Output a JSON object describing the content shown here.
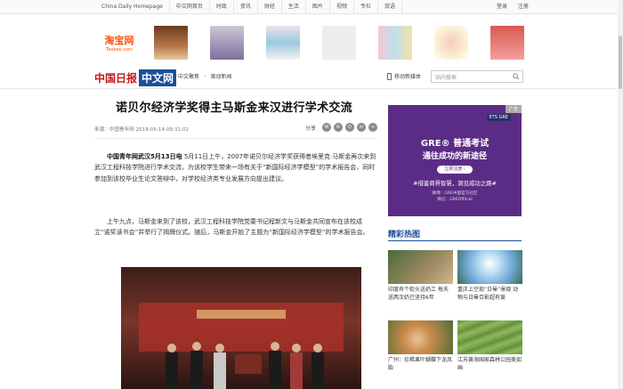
{
  "topnav": {
    "links": [
      "China Daily Homepage",
      "中文网首页",
      "时政",
      "资讯",
      "财经",
      "生活",
      "图片",
      "视频",
      "专栏",
      "双语"
    ],
    "login": "登录",
    "register": "注册"
  },
  "ads": {
    "taobao_logo": "淘宝网",
    "taobao_sub": "Taobao.com"
  },
  "header": {
    "logo_cn": "中国日报",
    "logo_site": "中文网",
    "breadcrumb": [
      "中文聚焦",
      "滚动新闻"
    ],
    "mobile_label": "移动新媒体",
    "search_placeholder": "站内搜索"
  },
  "article": {
    "title": "诺贝尔经济学奖得主马斯金来汉进行学术交流",
    "source": "来源：中国青年网 2018-05-14 09:31:02",
    "share_label": "分享",
    "share_icons": [
      "weibo-icon",
      "wechat-icon",
      "qq-icon",
      "linkedin-icon",
      "plus-icon"
    ],
    "lead": "中国青年网武汉5月13日电",
    "p1": " 5月11日上午，2007年诺贝尔经济学奖获得者埃里克·马斯金再次来到武汉工程科技学院进行学术交流，为该校学生带来一场有关于“新国际经济学模型”的学术报告会，同时参加到该校毕业生论文答辩中，对学校经济类专业发展方向提出建议。",
    "p2": "上午九点，马斯金来到了该校，武汉工程科技学院党委书记程新文与马斯金共同宣布在该校成立“诺奖读书会”并举行了揭牌仪式。随后，马斯金开始了主题为“新国际经济学模型”的学术报告会。"
  },
  "sidebar": {
    "ad_badge": "广告",
    "ad_ets": "ETS GRE",
    "ad_headline1": "GRE® 普通考试",
    "ad_headline2": "通往成功的新途径",
    "ad_button": "立即注册 ›",
    "ad_tagline": "#借鉴商界智慧，洞见成功之路#",
    "ad_weibo": "微博：GRE中国官方社区",
    "ad_wechat": "微信：GREOfficial",
    "section_title": "精彩热图",
    "cards": [
      {
        "caption": "印度有个街头送奶工 每天送两次奶已坚持6年"
      },
      {
        "caption": "重庆上空现“日晕”景观 动物与日晕合影超有爱"
      },
      {
        "caption": "广州：珍稀果叶蝴蝶下龙凤胎"
      },
      {
        "caption": "江苏黄海国家森林公园美如画"
      }
    ]
  }
}
